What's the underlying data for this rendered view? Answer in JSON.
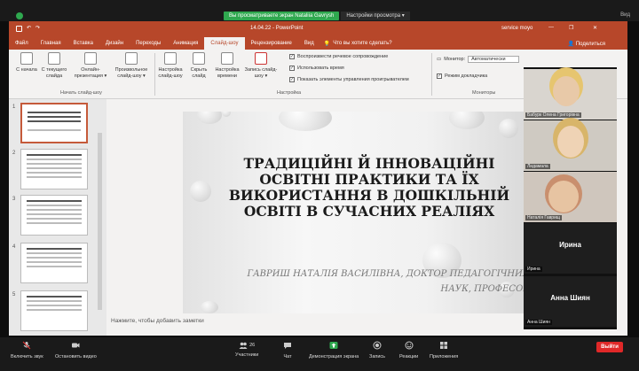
{
  "share_bar": {
    "green_text": "Вы просматриваете экран Nataliia Gavrysh",
    "view_options": "Настройки просмотра ▾",
    "view_mode": "Вид"
  },
  "ppt": {
    "quick": "14.04.22 - PowerPoint",
    "user": "service moyo",
    "tabs": [
      "Файл",
      "Главная",
      "Вставка",
      "Дизайн",
      "Переходы",
      "Анимация",
      "Слайд-шоу",
      "Рецензирование",
      "Вид"
    ],
    "tell": "Что вы хотите сделать?",
    "share": "Поделиться",
    "ribbon": {
      "b1": "С начала",
      "b2": "С текущего слайда",
      "b3": "Онлайн-презентация ▾",
      "b4": "Произвольное слайд-шоу ▾",
      "group1": "Начать слайд-шоу",
      "b5": "Настройка слайд-шоу",
      "b6": "Скрыть слайд",
      "b7": "Настройка времени",
      "b8": "Запись слайд-шоу ▾",
      "c1": "Воспроизвести речевое сопровождение",
      "c2": "Использовать время",
      "c3": "Показать элементы управления проигрывателем",
      "group2": "Настройка",
      "monitor_label": "Монитор:",
      "monitor_value": "Автоматически",
      "c4": "Режим докладчика",
      "group3": "Мониторы"
    },
    "slide_numbers": [
      "1",
      "2",
      "3",
      "4",
      "5"
    ],
    "slide": {
      "title": "ТРАДИЦІЙНІ Й ІННОВАЦІЙНІ ОСВІТНІ ПРАКТИКИ ТА ЇХ ВИКОРИСТАННЯ В ДОШКІЛЬНІЙ ОСВІТІ В СУЧАСНИХ РЕАЛІЯХ",
      "subtitle": "ГАВРИШ НАТАЛІЯ ВАСИЛІВНА, ДОКТОР ПЕДАГОГІЧНИХ НАУК, ПРОФЕСОР"
    },
    "notes": "Нажмите, чтобы добавить заметки"
  },
  "participants": [
    {
      "label": "Бабурк Олена Григорівна"
    },
    {
      "label": "Лидамала"
    },
    {
      "label": "Наталія Гаврищ"
    },
    {
      "label": "Ирина",
      "big": "Ирина"
    },
    {
      "label": "Анна Шиян",
      "big": "Анна Шиян"
    }
  ],
  "toolbar": {
    "audio": "Включить звук",
    "video": "Остановить видео",
    "participants": "Участники",
    "participants_count": "26",
    "chat": "Чат",
    "share": "Демонстрация экрана",
    "record": "Запись",
    "reactions": "Реакции",
    "apps": "Приложения",
    "leave": "Выйти"
  },
  "colors": {
    "ppt_red": "#b7472a",
    "zoom_green": "#2fa84f",
    "leave_red": "#e02828"
  }
}
